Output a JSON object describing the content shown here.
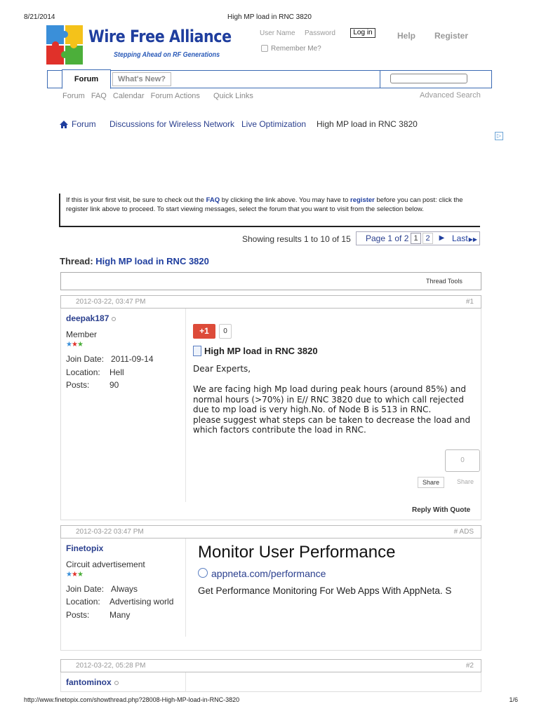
{
  "print": {
    "date": "8/21/2014",
    "title": "High MP load in RNC 3820",
    "url": "http://www.finetopix.com/showthread.php?28008-High-MP-load-in-RNC-3820",
    "page": "1/6"
  },
  "logo": {
    "name": "Wire Free Alliance",
    "tagline": "Stepping Ahead on RF Generations"
  },
  "login": {
    "user_placeholder": "User Name",
    "pass_placeholder": "Password",
    "login_label": "Log in",
    "remember_label": "Remember Me?",
    "help_label": "Help",
    "register_label": "Register"
  },
  "tabs": {
    "forum": "Forum",
    "whats_new": "What's New?"
  },
  "subnav": {
    "items": [
      "Forum",
      "FAQ",
      "Calendar",
      "Forum Actions",
      "Quick Links"
    ],
    "advanced_search": "Advanced Search"
  },
  "breadcrumb": {
    "forum": "Forum",
    "discussions": "Discussions for Wireless Network",
    "live": "Live Optimization",
    "current": "High MP load in RNC 3820"
  },
  "notice": {
    "part1": "If this is your first visit, be sure to check out the ",
    "faq": "FAQ",
    "part2": " by clicking the link above. You may have to ",
    "register": "register",
    "part3": " before you can post: click the register link above to proceed. To start viewing messages, select the forum that you want to visit from the selection below."
  },
  "pagination": {
    "showing": "Showing results 1 to 10 of 15",
    "page_of": "Page 1 of 2",
    "p1": "1",
    "p2": "2",
    "last": "Last"
  },
  "thread": {
    "prefix": "Thread: ",
    "title": "High MP load in RNC 3820",
    "tools": "Thread Tools"
  },
  "labels": {
    "join_date": "Join Date:",
    "location": "Location:",
    "posts": "Posts:"
  },
  "posts": [
    {
      "date": "2012-03-22, 03:47 PM",
      "num": "#1",
      "user": "deepak187",
      "user_title": "Member",
      "join_date": "2011-09-14",
      "location": "Hell",
      "posts": "90",
      "gplus_label": "+1",
      "gplus_count": "0",
      "title": "High MP load in RNC 3820",
      "body": "Dear Experts,\n\nWe are facing high Mp load during peak hours (around 85%) and normal hours (>70%) in E// RNC 3820 due to which call rejected due to mp load is very high.No. of Node B is 513 in RNC.\nplease suggest what steps can be taken to decrease the load and which factors contribute the load in RNC.",
      "share_count": "0",
      "share_btn": "Share",
      "share_lbl": "Share",
      "reply_quote": "Reply With Quote"
    },
    {
      "date": "2012-03-22 03:47 PM",
      "num": "# ADS",
      "user": "Finetopix",
      "user_title": "Circuit advertisement",
      "join_date": "Always",
      "location": "Advertising world",
      "posts": "Many",
      "ad_headline": "Monitor User Performance",
      "ad_link": "appneta.com/performance",
      "ad_desc": "Get Performance Monitoring For Web Apps With AppNeta. S"
    },
    {
      "date": "2012-03-22, 05:28 PM",
      "num": "#2",
      "user": "fantominox"
    }
  ],
  "colors": {
    "brand_blue": "#1f3e9e",
    "link": "#2a3f8e",
    "gplus": "#dd4b39"
  }
}
